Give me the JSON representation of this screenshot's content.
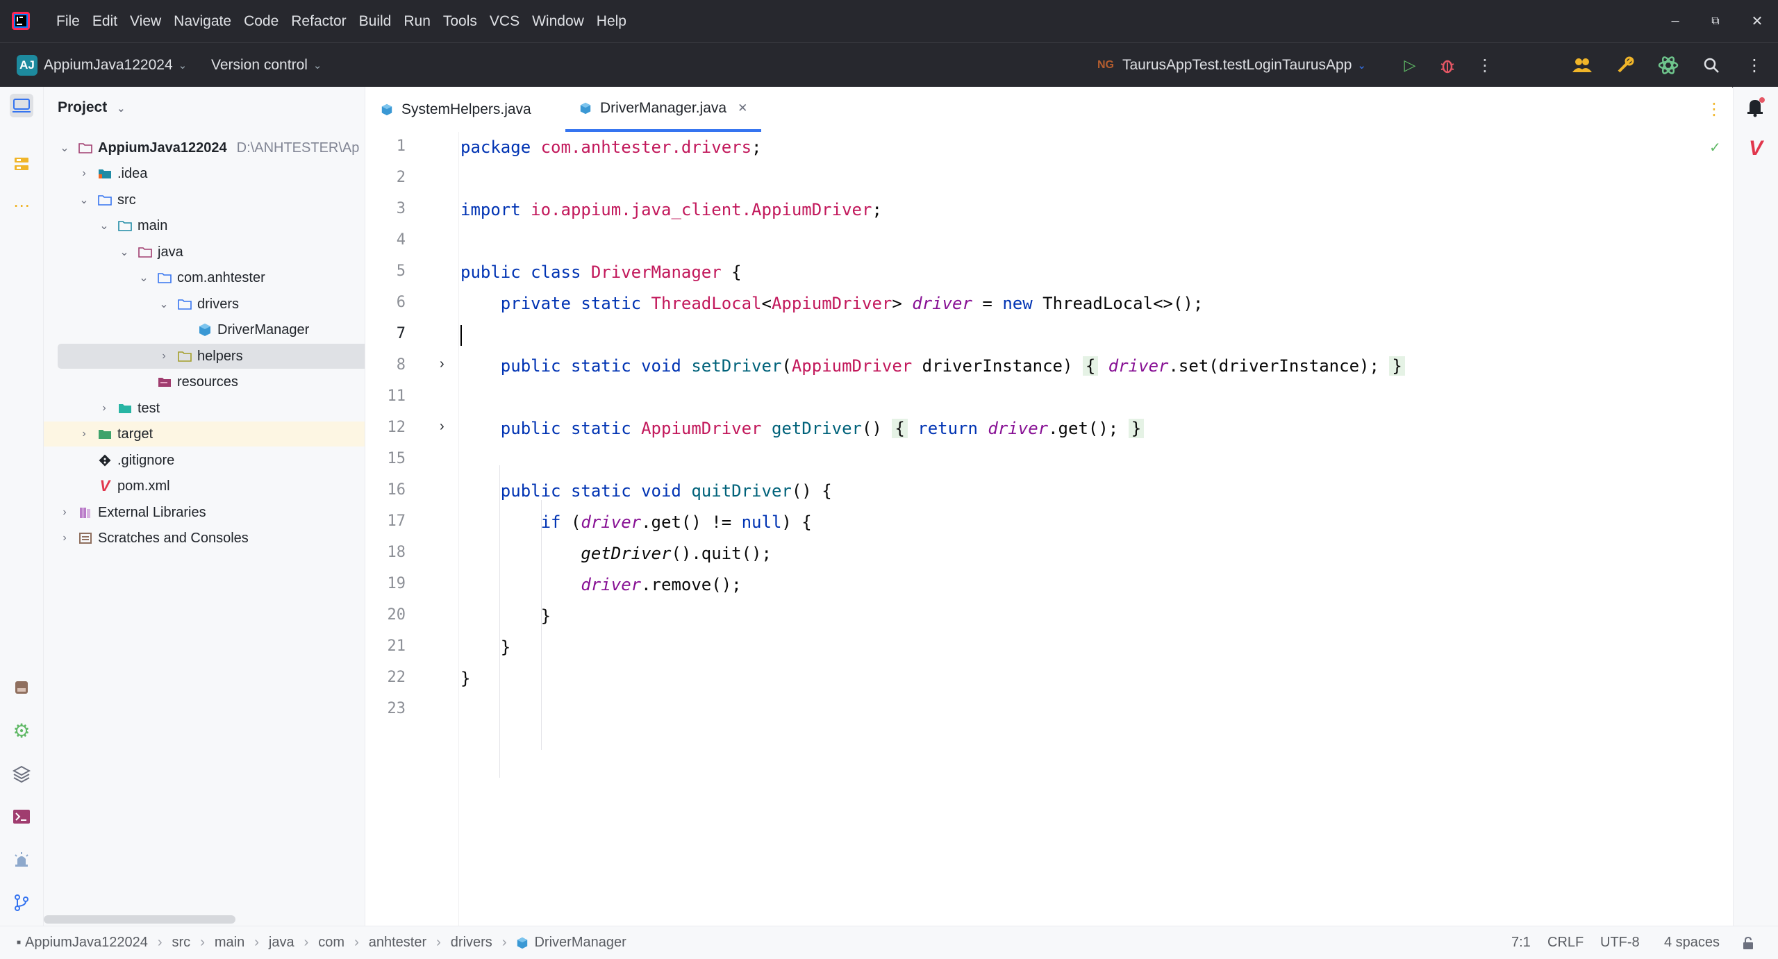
{
  "menubar": {
    "items": [
      "File",
      "Edit",
      "View",
      "Navigate",
      "Code",
      "Refactor",
      "Build",
      "Run",
      "Tools",
      "VCS",
      "Window",
      "Help"
    ]
  },
  "toolbar": {
    "project_badge": "AJ",
    "project_name": "AppiumJava122024",
    "version_control": "Version control",
    "run_config": "TaurusAppTest.testLoginTaurusApp"
  },
  "project_panel": {
    "title": "Project",
    "tree": [
      {
        "label": "AppiumJava122024",
        "sub": "D:\\ANHTESTER\\Ap",
        "bold": true
      },
      {
        "label": ".idea"
      },
      {
        "label": "src"
      },
      {
        "label": "main"
      },
      {
        "label": "java"
      },
      {
        "label": "com.anhtester"
      },
      {
        "label": "drivers"
      },
      {
        "label": "DriverManager"
      },
      {
        "label": "helpers"
      },
      {
        "label": "resources"
      },
      {
        "label": "test"
      },
      {
        "label": "target"
      },
      {
        "label": ".gitignore"
      },
      {
        "label": "pom.xml"
      },
      {
        "label": "External Libraries"
      },
      {
        "label": "Scratches and Consoles"
      }
    ]
  },
  "editor": {
    "tabs": [
      {
        "label": "SystemHelpers.java"
      },
      {
        "label": "DriverManager.java"
      }
    ],
    "line_numbers": [
      "1",
      "2",
      "3",
      "4",
      "5",
      "6",
      "7",
      "8",
      "11",
      "12",
      "15",
      "16",
      "17",
      "18",
      "19",
      "20",
      "21",
      "22",
      "23"
    ],
    "code": {
      "l1_kw": "package",
      "l1_pkg": "com.anhtester.drivers",
      "l1_end": ";",
      "l3_kw": "import",
      "l3_pkg": "io.appium.java_client.AppiumDriver",
      "l3_end": ";",
      "l5_kw": "public class",
      "l5_cls": "DriverManager",
      "l5_end": " {",
      "l6_kw": "private static",
      "l6_type": "ThreadLocal",
      "l6_gen": "AppiumDriver",
      "l6_field": "driver",
      "l6_new": "new",
      "l6_rest": " ThreadLocal<>();",
      "l8_kw": "public static void",
      "l8_m": "setDriver",
      "l8_type": "AppiumDriver",
      "l8_param": " driverInstance)",
      "l8_field": "driver",
      "l8_rest": ".set(driverInstance);",
      "l12_kw": "public static",
      "l12_type": "AppiumDriver",
      "l12_m": "getDriver",
      "l12_ret": "return",
      "l12_field": "driver",
      "l12_rest": ".get();",
      "l16_kw": "public static void",
      "l16_m": "quitDriver",
      "l16_rest": "() {",
      "l17_if": "if",
      "l17_field": "driver",
      "l17_mid": ".get() != ",
      "l17_null": "null",
      "l17_end": ") {",
      "l18_call": "getDriver",
      "l18_rest": "().quit();",
      "l19_field": "driver",
      "l19_rest": ".remove();",
      "l20": "}",
      "l21": "}",
      "l22": "}"
    }
  },
  "statusbar": {
    "crumbs": [
      "AppiumJava122024",
      "src",
      "main",
      "java",
      "com",
      "anhtester",
      "drivers",
      "DriverManager"
    ],
    "position": "7:1",
    "line_sep": "CRLF",
    "encoding": "UTF-8",
    "indent": "4 spaces"
  }
}
